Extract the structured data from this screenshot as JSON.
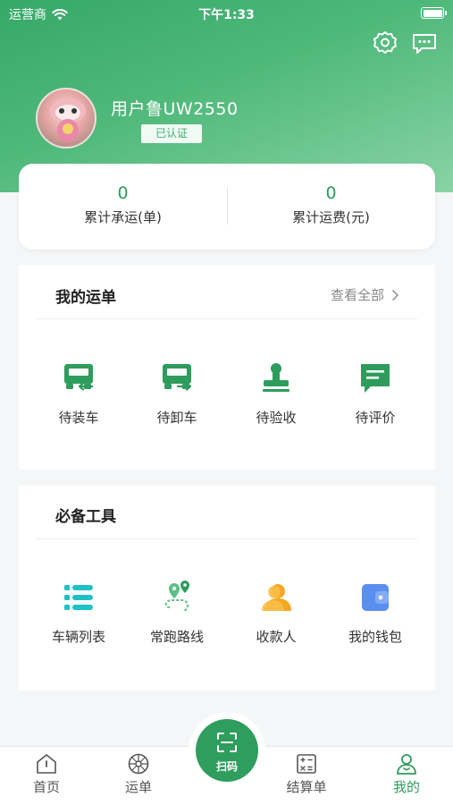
{
  "status_bar": {
    "carrier": "运营商",
    "time": "下午1:33"
  },
  "profile": {
    "name": "用户鲁UW2550",
    "badge": "已认证"
  },
  "stats": [
    {
      "value": "0",
      "label": "累计承运(单)"
    },
    {
      "value": "0",
      "label": "累计运费(元)"
    }
  ],
  "orders": {
    "title": "我的运单",
    "view_all": "查看全部",
    "items": [
      {
        "label": "待装车",
        "icon": "truck-load-icon"
      },
      {
        "label": "待卸车",
        "icon": "truck-unload-icon"
      },
      {
        "label": "待验收",
        "icon": "stamp-icon"
      },
      {
        "label": "待评价",
        "icon": "comment-icon"
      }
    ]
  },
  "tools": {
    "title": "必备工具",
    "items": [
      {
        "label": "车辆列表",
        "icon": "list-icon"
      },
      {
        "label": "常跑路线",
        "icon": "route-icon"
      },
      {
        "label": "收款人",
        "icon": "payee-icon"
      },
      {
        "label": "我的钱包",
        "icon": "wallet-icon"
      }
    ]
  },
  "tabbar": {
    "items": [
      {
        "label": "首页",
        "icon": "home-icon"
      },
      {
        "label": "运单",
        "icon": "wheel-icon"
      },
      {
        "label": "结算单",
        "icon": "calculator-icon"
      },
      {
        "label": "我的",
        "icon": "person-icon"
      }
    ],
    "scan_label": "扫码",
    "active": "我的"
  },
  "colors": {
    "primary": "#2e9c5c",
    "accent_orange": "#f5a623",
    "accent_blue": "#4a7ee8",
    "accent_cyan": "#1fc1c4"
  }
}
